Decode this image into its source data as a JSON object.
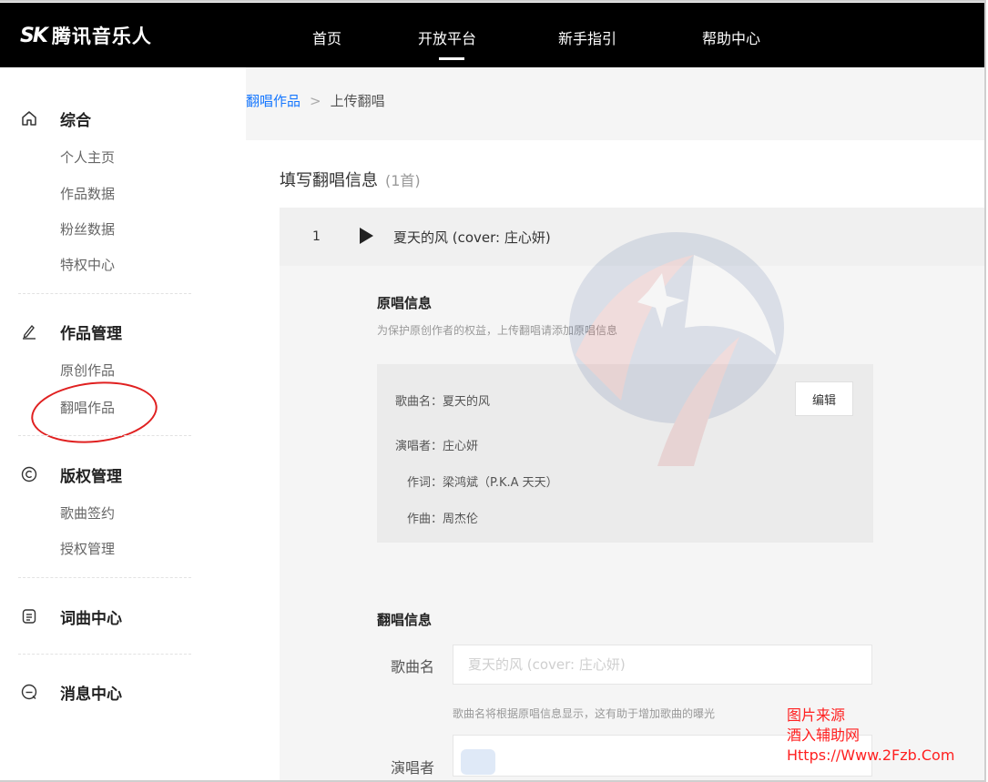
{
  "header": {
    "logo_mark": "ЅK",
    "logo_text": "腾讯音乐人",
    "nav": [
      {
        "label": "首页"
      },
      {
        "label": "开放平台"
      },
      {
        "label": "新手指引"
      },
      {
        "label": "帮助中心"
      }
    ]
  },
  "sidebar": {
    "sections": [
      {
        "title": "综合",
        "icon": "home-icon",
        "items": [
          "个人主页",
          "作品数据",
          "粉丝数据",
          "特权中心"
        ]
      },
      {
        "title": "作品管理",
        "icon": "pen-icon",
        "items": [
          "原创作品",
          "翻唱作品"
        ]
      },
      {
        "title": "版权管理",
        "icon": "copyright-icon",
        "items": [
          "歌曲签约",
          "授权管理"
        ]
      },
      {
        "title": "词曲中心",
        "icon": "document-icon",
        "items": []
      },
      {
        "title": "消息中心",
        "icon": "message-icon",
        "items": []
      }
    ]
  },
  "breadcrumb": {
    "link": "翻唱作品",
    "separator": ">",
    "current": "上传翻唱"
  },
  "card": {
    "title": "填写翻唱信息",
    "count": "(1首)",
    "song": {
      "index": "1",
      "name": "夏天的风 (cover: 庄心妍)"
    },
    "original": {
      "title": "原唱信息",
      "hint": "为保护原创作者的权益，上传翻唱请添加原唱信息",
      "song_label": "歌曲名：夏天的风",
      "singer_label": "演唱者：庄心妍",
      "lyricist_label": "作词：梁鸿斌（P.K.A 天天）",
      "composer_label": "作曲：周杰伦",
      "edit_label": "编辑"
    },
    "cover": {
      "title": "翻唱信息",
      "song_field_label": "歌曲名",
      "song_field_placeholder": "夏天的风 (cover: 庄心妍)",
      "song_help": "歌曲名将根据原唱信息显示，这有助于增加歌曲的曝光",
      "singer_field_label": "演唱者"
    }
  },
  "stamp": {
    "line1": "图片来源",
    "line2": "酒入辅助网",
    "line3": "Https://Www.2Fzb.Com"
  },
  "colors": {
    "accent": "#1677ff",
    "topbar": "#000000",
    "annotation": "#e02020"
  }
}
